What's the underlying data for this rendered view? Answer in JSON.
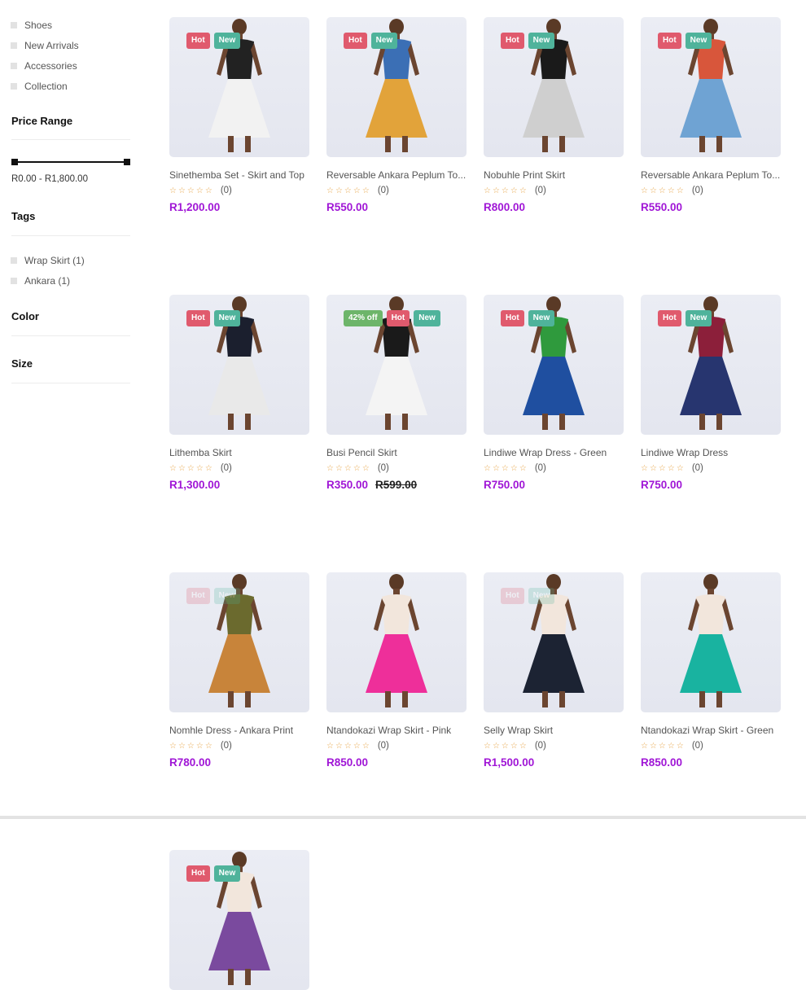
{
  "sidebar": {
    "categories": [
      "Shoes",
      "New Arrivals",
      "Accessories",
      "Collection"
    ],
    "price_range": {
      "title": "Price Range",
      "text": "R0.00 - R1,800.00"
    },
    "tags": {
      "title": "Tags",
      "items": [
        "Wrap Skirt (1)",
        "Ankara (1)"
      ]
    },
    "color_title": "Color",
    "size_title": "Size"
  },
  "rating_empty": "☆☆☆☆☆",
  "products": [
    {
      "name": "Sinethemba Set - Skirt and Top",
      "price": "R1,200.00",
      "reviews": "(0)",
      "badges": [
        "Hot",
        "New"
      ],
      "colors": [
        "#222222",
        "#f2f2f2"
      ]
    },
    {
      "name": "Reversable Ankara Peplum To...",
      "price": "R550.00",
      "reviews": "(0)",
      "badges": [
        "Hot",
        "New"
      ],
      "colors": [
        "#3b6fb5",
        "#e2a33a"
      ]
    },
    {
      "name": "Nobuhle Print Skirt",
      "price": "R800.00",
      "reviews": "(0)",
      "badges": [
        "Hot",
        "New"
      ],
      "colors": [
        "#1a1a1a",
        "#cfcfcf"
      ]
    },
    {
      "name": "Reversable Ankara Peplum To...",
      "price": "R550.00",
      "reviews": "(0)",
      "badges": [
        "Hot",
        "New"
      ],
      "colors": [
        "#d8563b",
        "#6fa3d3"
      ]
    },
    {
      "name": "Lithemba Skirt",
      "price": "R1,300.00",
      "reviews": "(0)",
      "badges": [
        "Hot",
        "New"
      ],
      "colors": [
        "#1b1f2e",
        "#e9e9e9"
      ]
    },
    {
      "name": "Busi Pencil Skirt",
      "price": "R350.00",
      "old_price": "R599.00",
      "reviews": "(0)",
      "badges": [
        "42% off",
        "Hot",
        "New"
      ],
      "colors": [
        "#1a1a1a",
        "#f4f4f4"
      ]
    },
    {
      "name": "Lindiwe Wrap Dress - Green",
      "price": "R750.00",
      "reviews": "(0)",
      "badges": [
        "Hot",
        "New"
      ],
      "colors": [
        "#2f9a3d",
        "#1f4fa0"
      ]
    },
    {
      "name": "Lindiwe Wrap Dress",
      "price": "R750.00",
      "reviews": "(0)",
      "badges": [
        "Hot",
        "New"
      ],
      "colors": [
        "#8c1f3a",
        "#27356f"
      ]
    },
    {
      "name": "Nomhle Dress - Ankara Print",
      "price": "R780.00",
      "reviews": "(0)",
      "badges": [
        "Hot",
        "New"
      ],
      "faint": true,
      "colors": [
        "#6b6a2e",
        "#c8843a"
      ]
    },
    {
      "name": "Ntandokazi Wrap Skirt - Pink",
      "price": "R850.00",
      "reviews": "(0)",
      "badges": [],
      "colors": [
        "#f2e6dc",
        "#ee2f9a"
      ]
    },
    {
      "name": "Selly Wrap Skirt",
      "price": "R1,500.00",
      "reviews": "(0)",
      "badges": [
        "Hot",
        "New"
      ],
      "faint": true,
      "colors": [
        "#f2e6dc",
        "#1c2333"
      ]
    },
    {
      "name": "Ntandokazi Wrap Skirt - Green",
      "price": "R850.00",
      "reviews": "(0)",
      "badges": [],
      "colors": [
        "#f2e6dc",
        "#19b3a0"
      ]
    },
    {
      "name": "",
      "price": "",
      "reviews": "",
      "badges": [
        "Hot",
        "New"
      ],
      "colors": [
        "#f2e6dc",
        "#7a4a9e"
      ]
    }
  ]
}
